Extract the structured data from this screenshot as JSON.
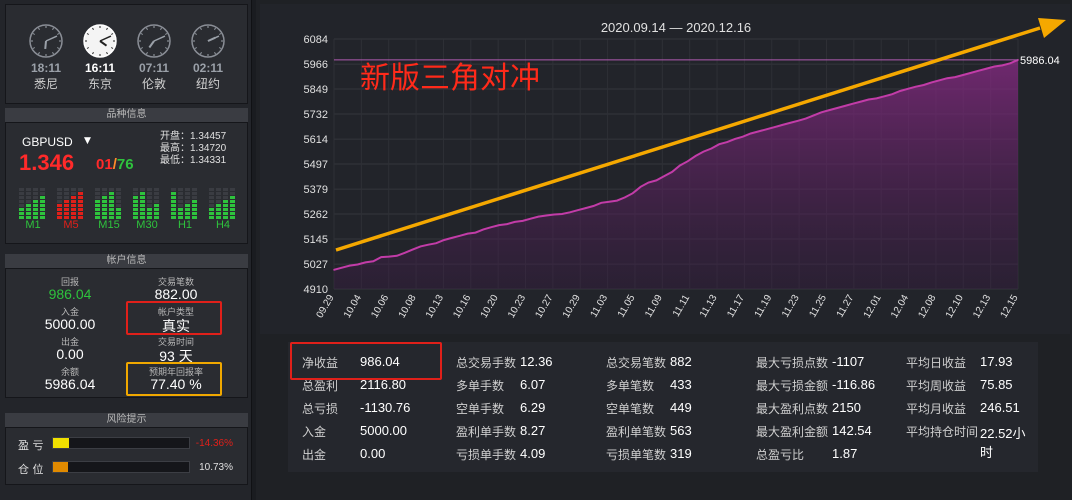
{
  "clocks": [
    {
      "time": "18:11",
      "city": "悉尼",
      "active": false,
      "hour": 6,
      "minute": 11
    },
    {
      "time": "16:11",
      "city": "东京",
      "active": true,
      "hour": 4,
      "minute": 11
    },
    {
      "time": "07:11",
      "city": "伦敦",
      "active": false,
      "hour": 7,
      "minute": 11
    },
    {
      "time": "02:11",
      "city": "纽约",
      "active": false,
      "hour": 2,
      "minute": 11
    }
  ],
  "symbol_section": {
    "title": "品种信息",
    "name": "GBPUSD",
    "price_main": "1.346",
    "price_tail_a": "01",
    "price_sep": "/",
    "price_tail_b": "76",
    "open": "开盘：1.34457",
    "high": "最高：1.34720",
    "low": "最低：1.34331",
    "timeframes": [
      {
        "label": "M1",
        "color": "#2ec33d"
      },
      {
        "label": "M5",
        "color": "#e0201a"
      },
      {
        "label": "M15",
        "color": "#2ec33d"
      },
      {
        "label": "M30",
        "color": "#2ec33d"
      },
      {
        "label": "H1",
        "color": "#2ec33d"
      },
      {
        "label": "H4",
        "color": "#2ec33d"
      }
    ]
  },
  "account_section": {
    "title": "帐户信息",
    "items": {
      "return_label": "回报",
      "return_value": "986.04",
      "trades_label": "交易笔数",
      "trades_value": "882.00",
      "deposit_label": "入金",
      "deposit_value": "5000.00",
      "type_label": "帐户类型",
      "type_value": "真实",
      "withdraw_label": "出金",
      "withdraw_value": "0.00",
      "time_label": "交易时间",
      "time_value": "93 天",
      "balance_label": "余额",
      "balance_value": "5986.04",
      "annual_label": "预期年回报率",
      "annual_value": "77.40 %"
    }
  },
  "risk_section": {
    "title": "风险提示",
    "pnl_label": "盈 亏",
    "pnl_value": "-14.36%",
    "pnl_fill": 0.12,
    "position_label": "仓 位",
    "position_value": "10.73%",
    "position_fill": 0.107
  },
  "chart_data": {
    "type": "area",
    "title": "2020.09.14 — 2020.12.16",
    "annotation": "新版三角对冲",
    "last_value_label": "5986.04",
    "ylim": [
      4910,
      6084
    ],
    "y_ticks": [
      "6084",
      "5966",
      "5849",
      "5732",
      "5614",
      "5497",
      "5379",
      "5262",
      "5145",
      "5027",
      "4910"
    ],
    "x_ticks": [
      "09.29",
      "10.04",
      "10.06",
      "10.08",
      "10.13",
      "10.16",
      "10.20",
      "10.23",
      "10.27",
      "10.29",
      "11.03",
      "11.05",
      "11.09",
      "11.11",
      "11.13",
      "11.17",
      "11.19",
      "11.23",
      "11.25",
      "11.27",
      "12.01",
      "12.04",
      "12.08",
      "12.10",
      "12.13",
      "12.15"
    ],
    "values": [
      5000,
      5010,
      5020,
      5025,
      5035,
      5040,
      5060,
      5062,
      5066,
      5080,
      5095,
      5110,
      5118,
      5125,
      5140,
      5150,
      5160,
      5170,
      5175,
      5190,
      5200,
      5210,
      5215,
      5225,
      5230,
      5240,
      5250,
      5255,
      5260,
      5262,
      5270,
      5280,
      5290,
      5300,
      5315,
      5320,
      5325,
      5340,
      5360,
      5390,
      5410,
      5420,
      5440,
      5460,
      5490,
      5510,
      5535,
      5555,
      5570,
      5590,
      5600,
      5615,
      5625,
      5640,
      5650,
      5660,
      5670,
      5680,
      5690,
      5700,
      5710,
      5725,
      5740,
      5750,
      5760,
      5770,
      5780,
      5790,
      5800,
      5805,
      5815,
      5825,
      5840,
      5850,
      5860,
      5868,
      5880,
      5890,
      5900,
      5905,
      5915,
      5925,
      5935,
      5945,
      5955,
      5960,
      5970,
      5986.04
    ],
    "line_color": "#c23ca8",
    "arrow_color": "#f5a800"
  },
  "stats": {
    "col1": [
      {
        "label": "净收益",
        "value": "986.04"
      },
      {
        "label": "总盈利",
        "value": "2116.80"
      },
      {
        "label": "总亏损",
        "value": "-1130.76"
      },
      {
        "label": "入金",
        "value": "5000.00"
      },
      {
        "label": "出金",
        "value": "0.00"
      }
    ],
    "col2": [
      {
        "label": "总交易手数",
        "value": "12.36"
      },
      {
        "label": "多单手数",
        "value": "6.07"
      },
      {
        "label": "空单手数",
        "value": "6.29"
      },
      {
        "label": "盈利单手数",
        "value": "8.27"
      },
      {
        "label": "亏损单手数",
        "value": "4.09"
      }
    ],
    "col3": [
      {
        "label": "总交易笔数",
        "value": "882"
      },
      {
        "label": "多单笔数",
        "value": "433"
      },
      {
        "label": "空单笔数",
        "value": "449"
      },
      {
        "label": "盈利单笔数",
        "value": "563"
      },
      {
        "label": "亏损单笔数",
        "value": "319"
      }
    ],
    "col4": [
      {
        "label": "最大亏损点数",
        "value": "-1107"
      },
      {
        "label": "最大亏损金额",
        "value": "-116.86"
      },
      {
        "label": "最大盈利点数",
        "value": "2150"
      },
      {
        "label": "最大盈利金额",
        "value": "142.54"
      },
      {
        "label": "总盈亏比",
        "value": "1.87"
      }
    ],
    "col5": [
      {
        "label": "平均日收益",
        "value": "17.93"
      },
      {
        "label": "平均周收益",
        "value": "75.85"
      },
      {
        "label": "平均月收益",
        "value": "246.51"
      },
      {
        "label": "平均持仓时间",
        "value": "22.52小时"
      }
    ]
  }
}
